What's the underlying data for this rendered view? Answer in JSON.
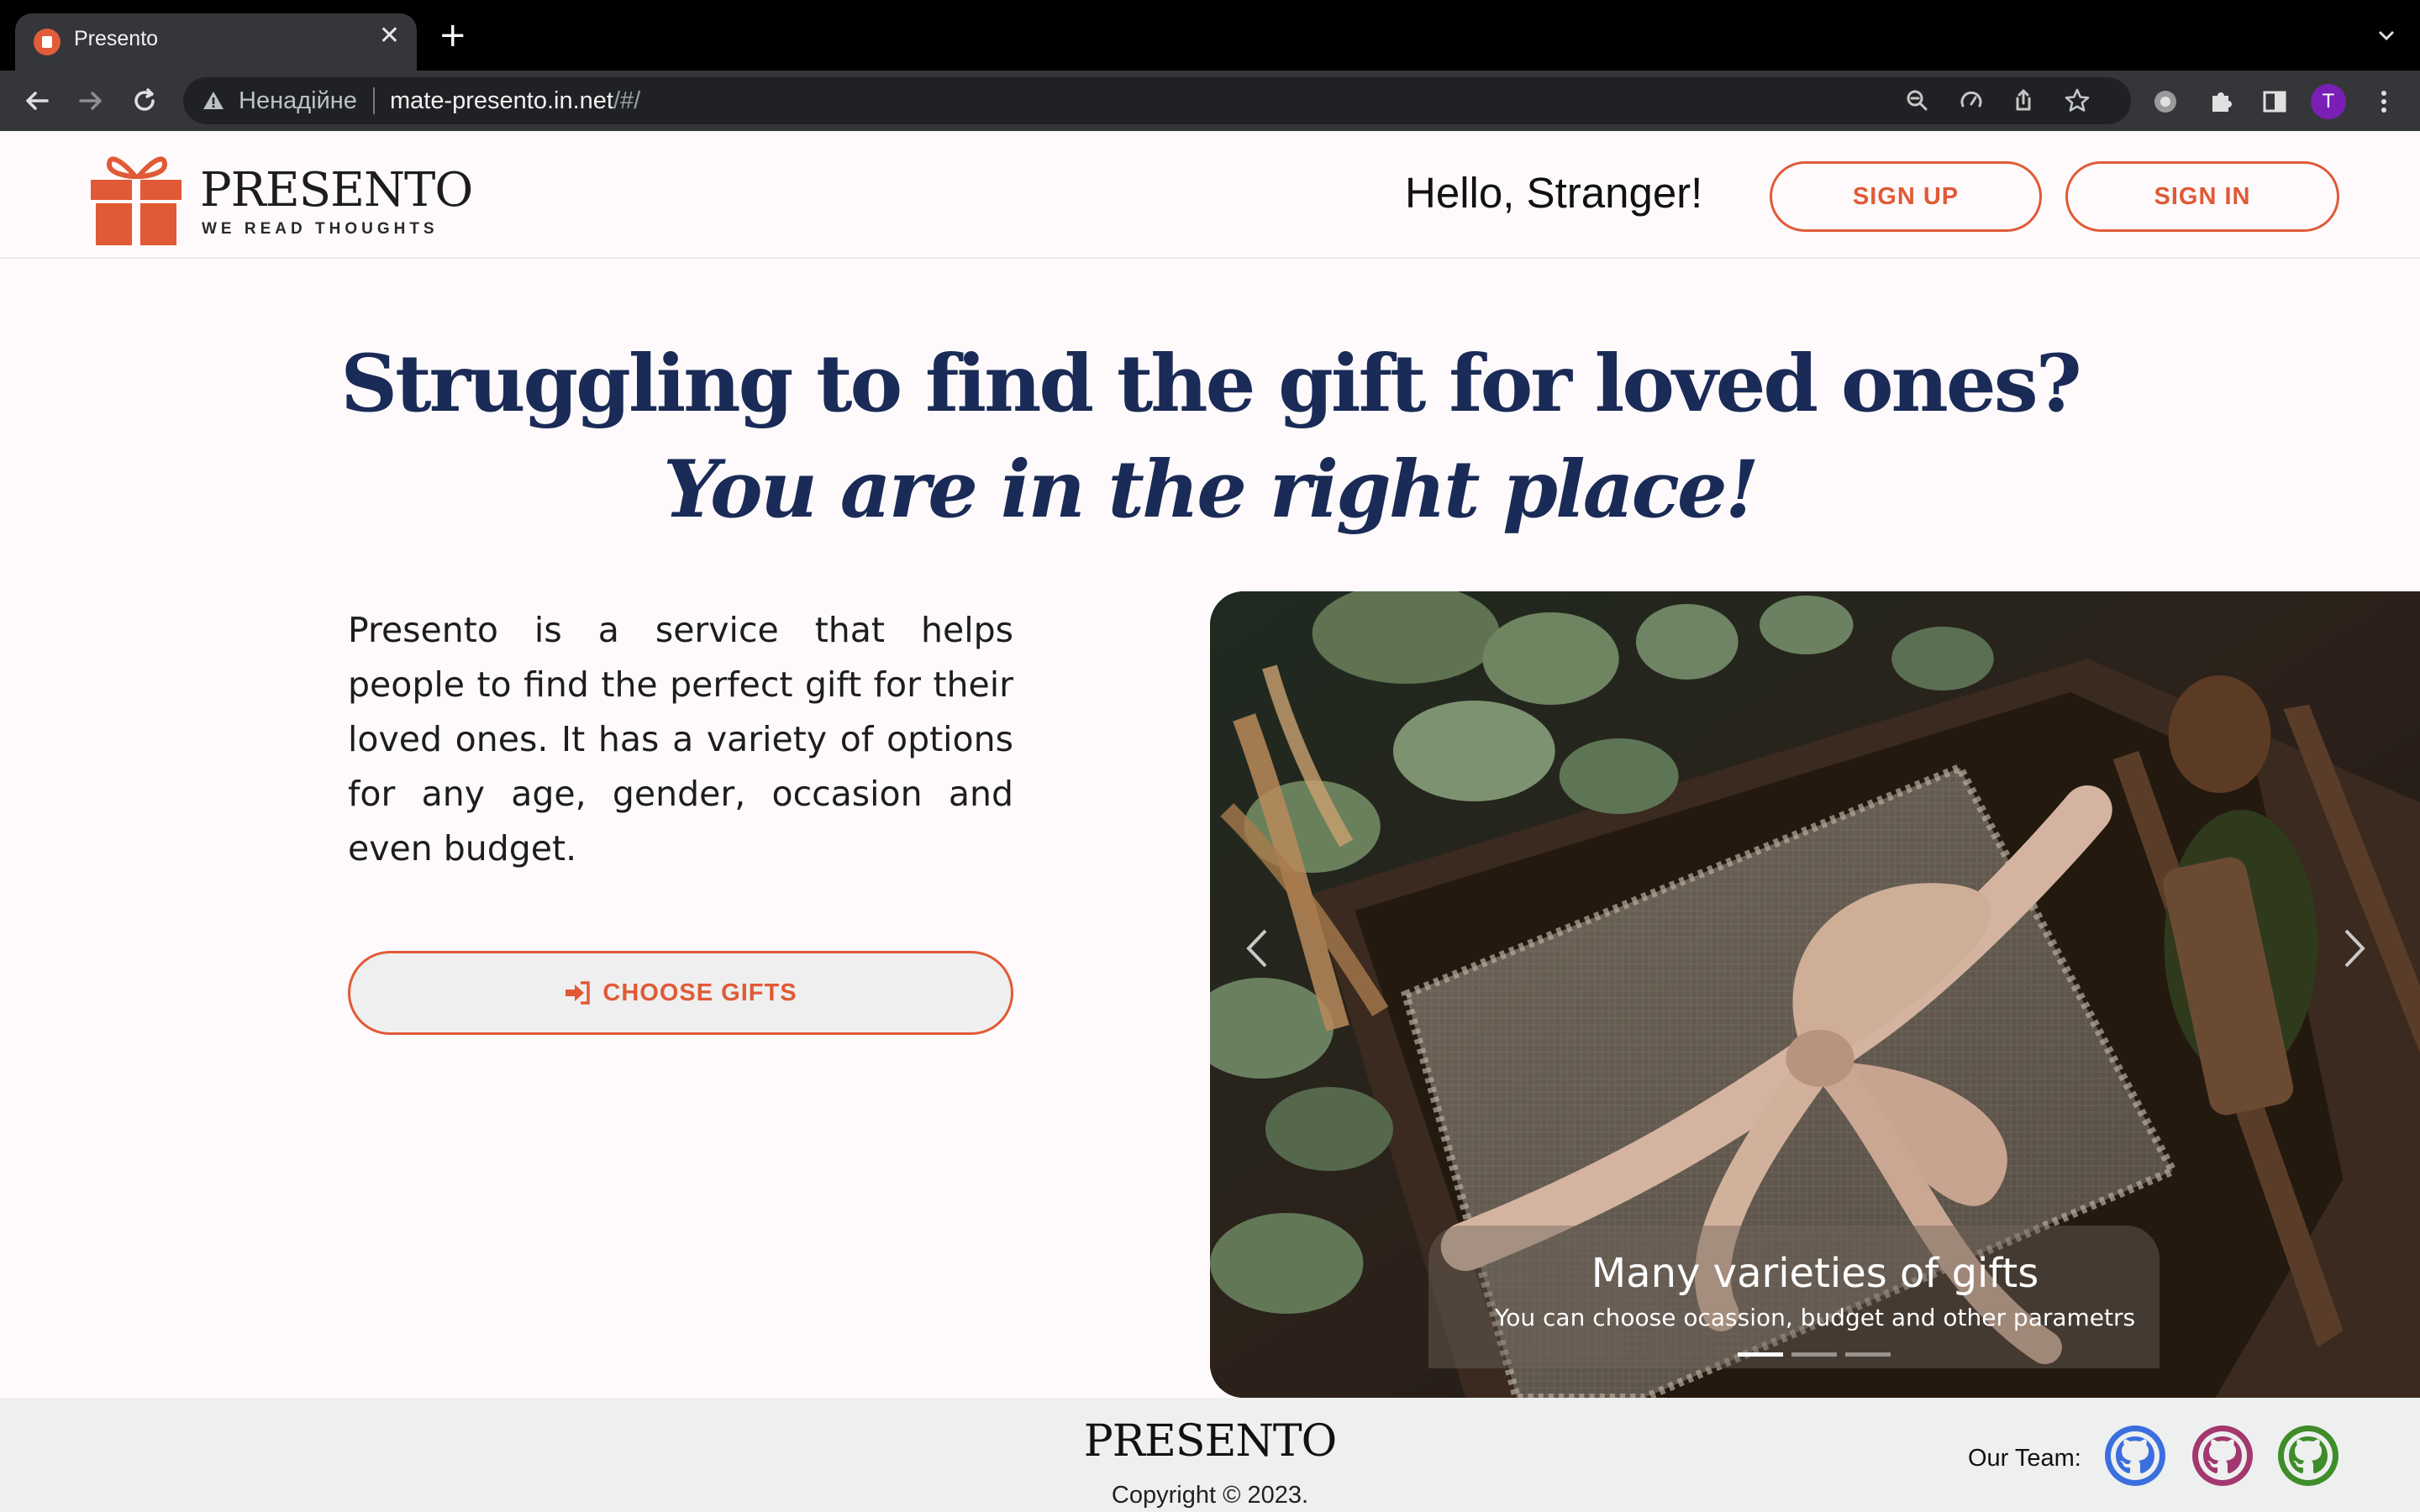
{
  "browser": {
    "tab_title": "Presento",
    "tab_close": "✕",
    "new_tab": "+",
    "insecure_label": "Ненадійне",
    "url_host": "mate-presento.in.net",
    "url_path": "/#/",
    "profile_initial": "T",
    "icons": [
      "back-icon",
      "forward-icon",
      "reload-icon",
      "warning-icon",
      "zoom-icon",
      "performance-icon",
      "share-icon",
      "bookmark-star-icon",
      "extension-icon",
      "puzzle-icon",
      "side-panel-icon",
      "menu-dots-icon"
    ]
  },
  "header": {
    "logo_word": "PRESENTO",
    "logo_tagline": "WE READ THOUGHTS",
    "greeting": "Hello, Stranger!",
    "signup_label": "SIGN UP",
    "signin_label": "SIGN IN"
  },
  "hero": {
    "title": "Struggling to find the gift for loved ones?",
    "subtitle": "You are in the right place!",
    "description": "Presento is a service that helps people to find the perfect gift for their loved ones. It has a variety of options for any age, gender, occasion and even budget.",
    "cta_label": "CHOOSE GIFTS"
  },
  "carousel": {
    "caption_title": "Many varieties of gifts",
    "caption_text": "You can choose ocassion, budget and other parametrs",
    "slide_count": 3,
    "active_slide": 1
  },
  "footer": {
    "logo_word": "PRESENTO",
    "copyright": "Copyright © 2023.",
    "team_label": "Our Team:",
    "team_icon_colors": [
      "#3b6fe0",
      "#a3386f",
      "#3f8c2a"
    ]
  },
  "colors": {
    "accent": "#e05a36",
    "heading": "#1b2b57",
    "page_bg": "#fefafb",
    "footer_bg": "#eef0ef"
  }
}
